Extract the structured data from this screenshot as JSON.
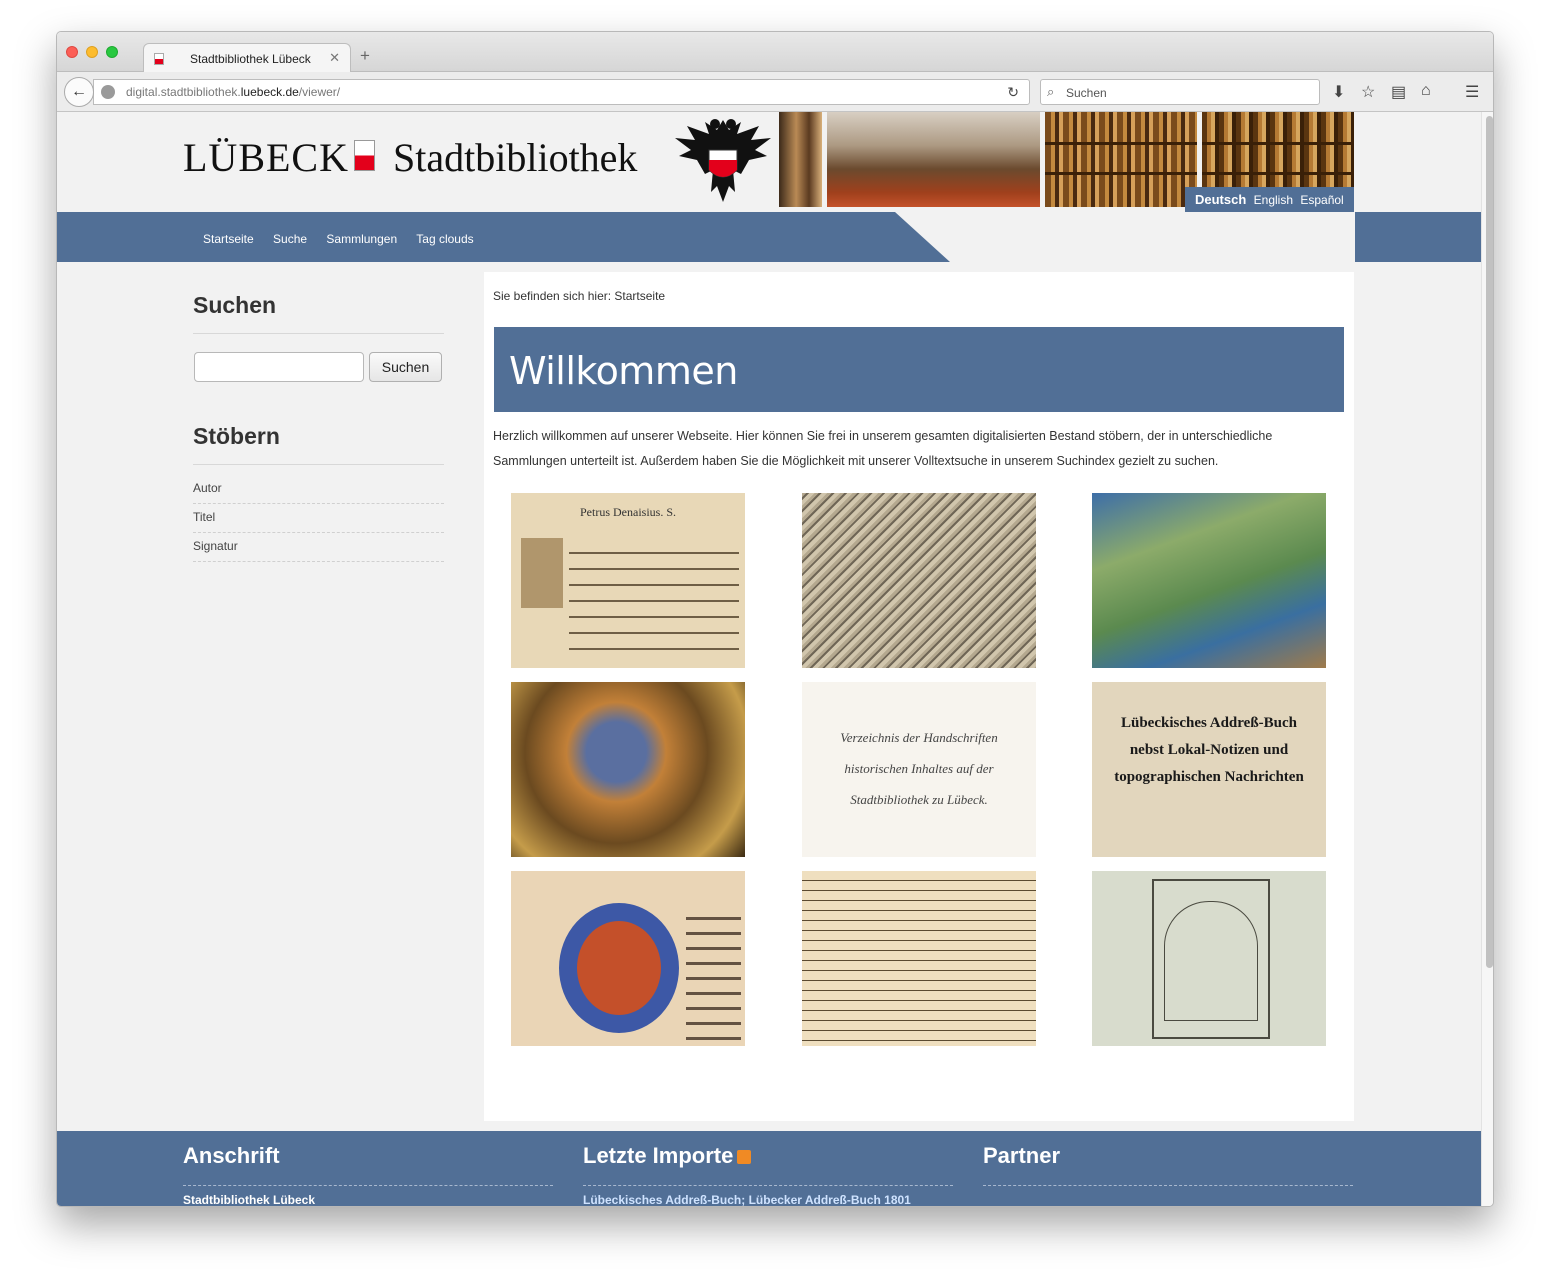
{
  "browser": {
    "tab_title": "Stadtbibliothek Lübeck",
    "url_prefix": "digital.stadtbibliothek.",
    "url_domain": "luebeck.de",
    "url_path": "/viewer/",
    "search_placeholder": "Suchen"
  },
  "header": {
    "logo_city": "LÜBECK",
    "logo_name": "Stadtbibliothek",
    "languages": [
      "Deutsch",
      "English",
      "Español"
    ],
    "active_language": "Deutsch"
  },
  "menu": [
    "Startseite",
    "Suche",
    "Sammlungen",
    "Tag clouds"
  ],
  "sidebar": {
    "search_heading": "Suchen",
    "search_button": "Suchen",
    "browse_heading": "Stöbern",
    "browse_items": [
      "Autor",
      "Titel",
      "Signatur"
    ]
  },
  "main": {
    "breadcrumb": "Sie befinden sich hier: Startseite",
    "title": "Willkommen",
    "intro_line1": "Herzlich willkommen auf unserer Webseite. Hier können Sie frei in unserem gesamten digitalisierten Bestand stöbern, der in unterschiedliche",
    "intro_line2": "Sammlungen unterteilt ist. Außerdem haben Sie die Möglichkeit mit unserer Volltextsuche in unserem Suchindex gezielt zu suchen.",
    "thumbnails": [
      {
        "text": "Petrus Denaisius. S."
      },
      {
        "text": ""
      },
      {
        "text": ""
      },
      {
        "text": ""
      },
      {
        "text": "Verzeichnis der Handschriften historischen Inhaltes auf der Stadtbibliothek zu Lübeck."
      },
      {
        "text": "Lübeckisches Addreß-Buch nebst Lokal-Notizen und topographischen Nachrichten"
      },
      {
        "text": ""
      },
      {
        "text": ""
      },
      {
        "text": ""
      }
    ]
  },
  "footer": {
    "col1_heading": "Anschrift",
    "col1_text": "Stadtbibliothek Lübeck",
    "col2_heading": "Letzte Importe",
    "col2_text": "Lübeckisches Addreß-Buch; Lübecker Addreß-Buch 1801",
    "col3_heading": "Partner"
  },
  "colors": {
    "brand_blue": "#516f96",
    "link_light": "#cfe3ff",
    "flag_red": "#e3001b"
  }
}
